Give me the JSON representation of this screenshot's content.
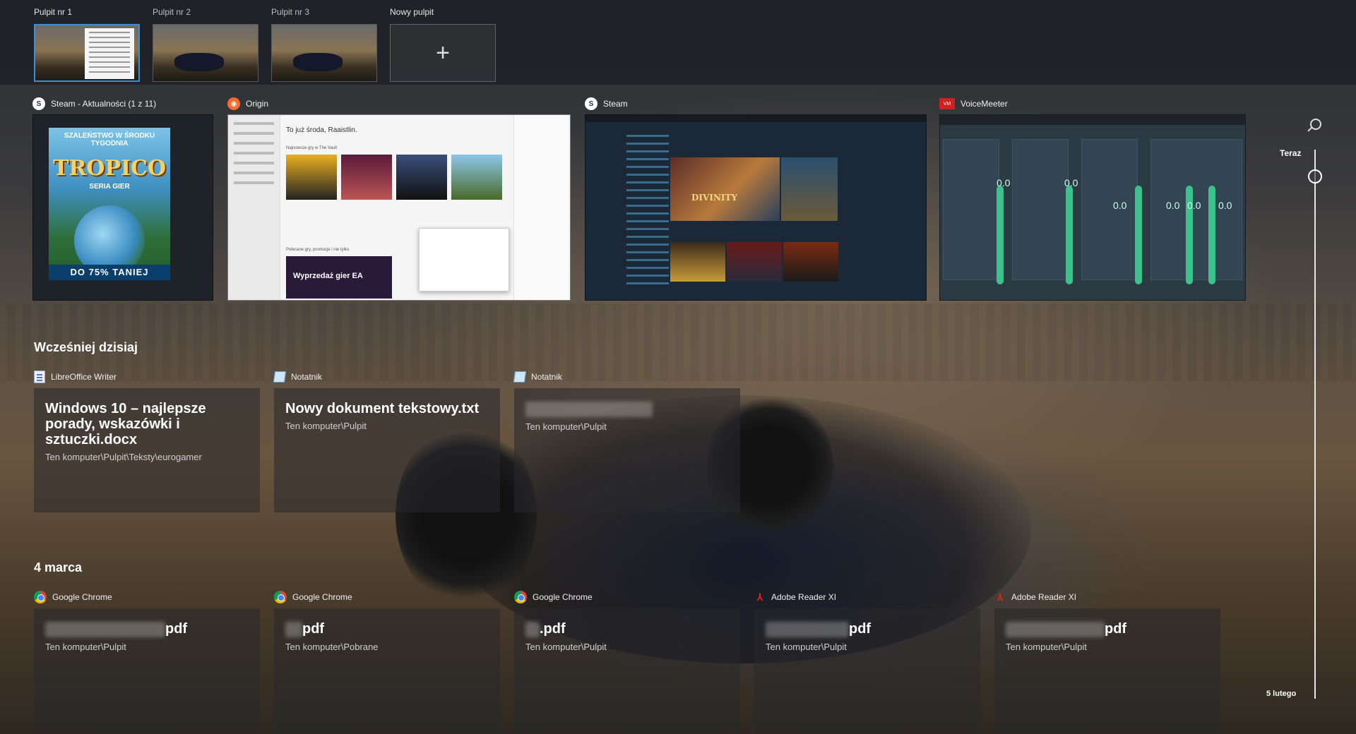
{
  "desktops": [
    {
      "label": "Pulpit nr 1",
      "active": true
    },
    {
      "label": "Pulpit nr 2",
      "active": false
    },
    {
      "label": "Pulpit nr 3",
      "active": false
    }
  ],
  "new_desktop": {
    "label": "Nowy pulpit",
    "icon": "plus-icon"
  },
  "windows": [
    {
      "title": "Steam - Aktualności (1 z 11)",
      "icon": "steam-icon",
      "content": {
        "top": "SZALEŃSTWO W ŚRODKU TYGODNIA",
        "title": "TROPICO",
        "subtitle": "SERIA GIER",
        "bottom": "DO 75% TANIEJ"
      }
    },
    {
      "title": "Origin",
      "icon": "origin-icon",
      "content": {
        "greeting": "To już środa, Raaistlin.",
        "section1": "Najnowsze gry w The Vault",
        "section2": "Polecane gry, promocje i nie tylko",
        "banner": "Wyprzedaż gier EA"
      }
    },
    {
      "title": "Steam",
      "icon": "steam-icon",
      "content": {
        "hero": "DIVINITY"
      }
    },
    {
      "title": "VoiceMeeter",
      "icon": "voicemeeter-icon",
      "content": {
        "values": [
          "0.0",
          "0.0",
          "0.0",
          "0.0",
          "0.0",
          "0.0"
        ]
      }
    }
  ],
  "timeline": {
    "now_label": "Teraz",
    "end_label": "5 lutego",
    "search_icon": "search-icon"
  },
  "sections": [
    {
      "title": "Wcześniej dzisiaj",
      "cards": [
        {
          "app": "LibreOffice Writer",
          "icon": "writer-icon",
          "title": "Windows 10 – najlepsze porady, wskazówki i sztuczki.docx",
          "path": "Ten komputer\\Pulpit\\Teksty\\eurogamer"
        },
        {
          "app": "Notatnik",
          "icon": "notepad-icon",
          "title": "Nowy dokument tekstowy.txt",
          "path": "Ten komputer\\Pulpit"
        },
        {
          "app": "Notatnik",
          "icon": "notepad-icon",
          "title": "",
          "path": "Ten komputer\\Pulpit"
        }
      ]
    },
    {
      "title": "4 marca",
      "cards": [
        {
          "app": "Google Chrome",
          "icon": "chrome-icon",
          "title": "pdf",
          "path": "Ten komputer\\Pulpit"
        },
        {
          "app": "Google Chrome",
          "icon": "chrome-icon",
          "title": "pdf",
          "path": "Ten komputer\\Pobrane"
        },
        {
          "app": "Google Chrome",
          "icon": "chrome-icon",
          "title": ".pdf",
          "path": "Ten komputer\\Pulpit"
        },
        {
          "app": "Adobe Reader XI",
          "icon": "pdf-icon",
          "title": "pdf",
          "path": "Ten komputer\\Pulpit"
        },
        {
          "app": "Adobe Reader XI",
          "icon": "pdf-icon",
          "title": "pdf",
          "path": "Ten komputer\\Pulpit"
        }
      ]
    }
  ]
}
